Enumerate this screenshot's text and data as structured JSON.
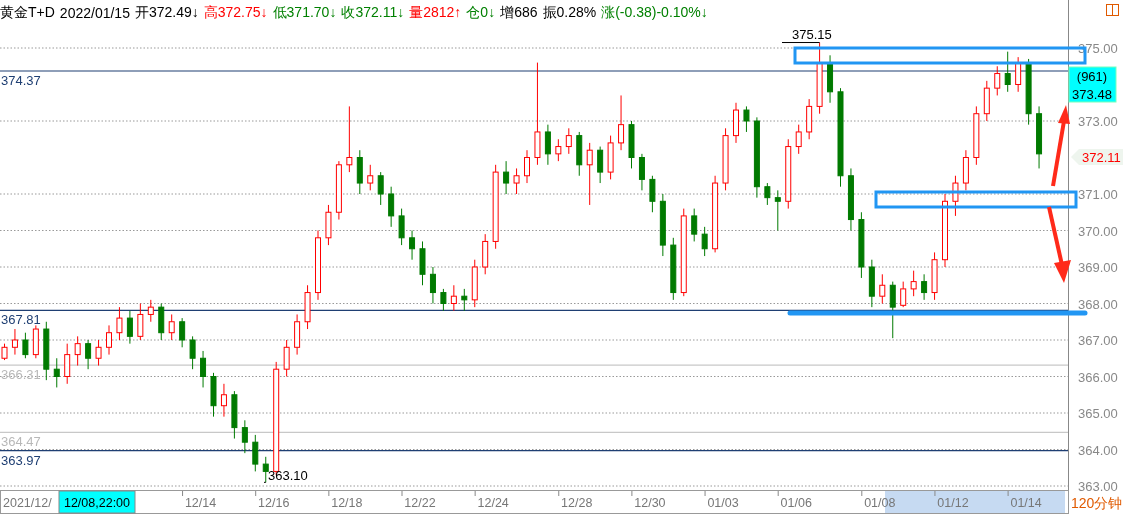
{
  "header": {
    "items": [
      {
        "text": "黄金T+D",
        "color": "#000000"
      },
      {
        "text": "2022/01/15",
        "color": "#000000"
      },
      {
        "text": "开372.49",
        "arrow": "↓",
        "color": "#000000"
      },
      {
        "text": "高372.75",
        "arrow": "↓",
        "color": "#ff0000"
      },
      {
        "text": "低371.70",
        "arrow": "↓",
        "color": "#008000"
      },
      {
        "text": "收372.11",
        "arrow": "↓",
        "color": "#008000"
      },
      {
        "text": "量2812",
        "arrow": "↑",
        "color": "#ff0000"
      },
      {
        "text": "仓0",
        "arrow": "↓",
        "color": "#008000"
      },
      {
        "text": "增686",
        "color": "#000000"
      },
      {
        "text": "振0.28%",
        "color": "#000000"
      },
      {
        "text": "涨(-0.38)-0.10%",
        "arrow": "↓",
        "color": "#008000"
      }
    ]
  },
  "chart": {
    "reference_lines": [
      {
        "label": "374.37",
        "kind": "strong"
      },
      {
        "label": "367.81",
        "kind": "strong"
      },
      {
        "label": "366.31",
        "kind": "faint"
      },
      {
        "label": "364.47",
        "kind": "faint"
      },
      {
        "label": "363.97",
        "kind": "strong"
      }
    ],
    "high_marker": "375.15",
    "low_marker": "363.10",
    "chart_data": {
      "type": "candlestick",
      "ylim": [
        363,
        375
      ],
      "grid": true,
      "yticks": [
        {
          "value": 375,
          "label": "375.00"
        },
        {
          "value": 373,
          "label": "373.00"
        },
        {
          "value": 371,
          "label": "371.00"
        },
        {
          "value": 370,
          "label": "370.00"
        },
        {
          "value": 369,
          "label": "369.00"
        },
        {
          "value": 368,
          "label": "368.00"
        },
        {
          "value": 367,
          "label": "367.00"
        },
        {
          "value": 366,
          "label": "366.00"
        },
        {
          "value": 365,
          "label": "365.00"
        },
        {
          "value": 364,
          "label": "364.00"
        },
        {
          "value": 363,
          "label": "363.00"
        }
      ],
      "categories": [
        null,
        null,
        null,
        null,
        null,
        null,
        null,
        null,
        null,
        null,
        null,
        null,
        null,
        null,
        null,
        null,
        null,
        null,
        null,
        "12/14",
        null,
        null,
        null,
        null,
        null,
        null,
        "12/16",
        null,
        null,
        null,
        null,
        null,
        null,
        "12/18",
        null,
        null,
        null,
        null,
        null,
        null,
        "12/22",
        null,
        null,
        null,
        null,
        null,
        null,
        "12/24",
        null,
        null,
        null,
        null,
        null,
        null,
        null,
        "12/28",
        null,
        null,
        null,
        null,
        null,
        null,
        "12/30",
        null,
        null,
        null,
        null,
        null,
        null,
        "01/03",
        null,
        null,
        null,
        null,
        null,
        null,
        "01/06",
        null,
        null,
        null,
        null,
        null,
        null,
        null,
        "01/08",
        null,
        null,
        null,
        null,
        null,
        null,
        "01/12",
        null,
        null,
        null,
        null,
        null,
        null,
        "01/14",
        null
      ],
      "ohlc": [
        [
          366.5,
          366.9,
          366.45,
          366.8
        ],
        [
          366.8,
          367.3,
          366.6,
          367.0
        ],
        [
          367.0,
          367.2,
          366.5,
          366.6
        ],
        [
          366.6,
          367.4,
          366.5,
          367.3
        ],
        [
          367.3,
          367.5,
          365.9,
          366.2
        ],
        [
          366.2,
          366.5,
          365.7,
          366.0
        ],
        [
          366.0,
          366.9,
          365.8,
          366.6
        ],
        [
          366.6,
          367.1,
          366.3,
          366.9
        ],
        [
          366.9,
          367.0,
          366.2,
          366.5
        ],
        [
          366.5,
          367.0,
          366.3,
          366.8
        ],
        [
          366.8,
          367.4,
          366.6,
          367.2
        ],
        [
          367.2,
          367.9,
          367.0,
          367.6
        ],
        [
          367.6,
          367.8,
          366.9,
          367.1
        ],
        [
          367.1,
          368.0,
          367.0,
          367.7
        ],
        [
          367.7,
          368.1,
          367.5,
          367.9
        ],
        [
          367.9,
          368.0,
          367.0,
          367.2
        ],
        [
          367.2,
          367.7,
          367.0,
          367.5
        ],
        [
          367.5,
          367.6,
          366.8,
          367.0
        ],
        [
          367.0,
          367.1,
          366.2,
          366.5
        ],
        [
          366.5,
          366.7,
          365.7,
          366.0
        ],
        [
          366.0,
          366.1,
          364.9,
          365.2
        ],
        [
          365.2,
          365.8,
          364.9,
          365.5
        ],
        [
          365.5,
          365.6,
          364.3,
          364.6
        ],
        [
          364.6,
          364.8,
          363.9,
          364.2
        ],
        [
          364.2,
          364.4,
          363.4,
          363.6
        ],
        [
          363.6,
          363.8,
          363.1,
          363.4
        ],
        [
          363.4,
          366.4,
          363.3,
          366.2
        ],
        [
          366.2,
          367.0,
          366.0,
          366.8
        ],
        [
          366.8,
          367.7,
          366.6,
          367.5
        ],
        [
          367.5,
          368.5,
          367.3,
          368.3
        ],
        [
          368.3,
          370.0,
          368.1,
          369.8
        ],
        [
          369.8,
          370.7,
          369.6,
          370.5
        ],
        [
          370.5,
          371.9,
          370.3,
          371.8
        ],
        [
          371.8,
          373.4,
          371.6,
          372.0
        ],
        [
          372.0,
          372.2,
          371.0,
          371.3
        ],
        [
          371.3,
          371.8,
          371.1,
          371.5
        ],
        [
          371.5,
          371.6,
          370.7,
          371.0
        ],
        [
          371.0,
          371.2,
          370.1,
          370.4
        ],
        [
          370.4,
          370.6,
          369.6,
          369.8
        ],
        [
          369.8,
          370.0,
          369.2,
          369.5
        ],
        [
          369.5,
          369.7,
          368.5,
          368.8
        ],
        [
          368.8,
          369.0,
          368.0,
          368.3
        ],
        [
          368.3,
          368.4,
          367.8,
          368.0
        ],
        [
          368.0,
          368.5,
          367.8,
          368.2
        ],
        [
          368.2,
          368.4,
          367.8,
          368.1
        ],
        [
          368.1,
          369.2,
          367.9,
          369.0
        ],
        [
          369.0,
          369.9,
          368.8,
          369.7
        ],
        [
          369.7,
          371.8,
          369.5,
          371.6
        ],
        [
          371.6,
          371.9,
          371.0,
          371.3
        ],
        [
          371.3,
          371.7,
          371.0,
          371.5
        ],
        [
          371.5,
          372.2,
          371.3,
          372.0
        ],
        [
          372.0,
          374.6,
          371.8,
          372.7
        ],
        [
          372.7,
          372.9,
          371.8,
          372.1
        ],
        [
          372.1,
          372.5,
          371.9,
          372.3
        ],
        [
          372.3,
          372.8,
          372.1,
          372.6
        ],
        [
          372.6,
          372.7,
          371.5,
          371.8
        ],
        [
          371.8,
          372.4,
          370.7,
          372.2
        ],
        [
          372.2,
          372.3,
          371.3,
          371.6
        ],
        [
          371.6,
          372.6,
          371.4,
          372.4
        ],
        [
          372.4,
          373.7,
          372.2,
          372.9
        ],
        [
          372.9,
          373.0,
          371.7,
          372.0
        ],
        [
          372.0,
          372.1,
          371.1,
          371.4
        ],
        [
          371.4,
          371.5,
          370.5,
          370.8
        ],
        [
          370.8,
          371.0,
          369.3,
          369.6
        ],
        [
          369.6,
          369.8,
          368.1,
          368.3
        ],
        [
          368.3,
          370.6,
          368.2,
          370.4
        ],
        [
          370.4,
          370.6,
          369.7,
          369.9
        ],
        [
          369.9,
          370.1,
          369.3,
          369.5
        ],
        [
          369.5,
          371.5,
          369.4,
          371.3
        ],
        [
          371.3,
          372.8,
          371.1,
          372.6
        ],
        [
          372.6,
          373.5,
          372.4,
          373.3
        ],
        [
          373.3,
          373.4,
          372.7,
          373.0
        ],
        [
          373.0,
          373.1,
          370.9,
          371.2
        ],
        [
          371.2,
          371.3,
          370.7,
          370.9
        ],
        [
          370.9,
          371.1,
          370.0,
          370.8
        ],
        [
          370.8,
          372.5,
          370.6,
          372.3
        ],
        [
          372.3,
          372.9,
          372.1,
          372.7
        ],
        [
          372.7,
          373.6,
          372.5,
          373.4
        ],
        [
          373.4,
          375.15,
          373.2,
          374.6
        ],
        [
          374.6,
          374.8,
          373.5,
          373.8
        ],
        [
          373.8,
          373.9,
          371.2,
          371.5
        ],
        [
          371.5,
          371.7,
          370.0,
          370.3
        ],
        [
          370.3,
          370.5,
          368.7,
          369.0
        ],
        [
          369.0,
          369.2,
          367.9,
          368.2
        ],
        [
          368.2,
          368.8,
          368.0,
          368.5
        ],
        [
          368.5,
          368.6,
          367.05,
          367.9
        ],
        [
          367.95,
          368.6,
          367.9,
          368.4
        ],
        [
          368.4,
          368.9,
          368.2,
          368.6
        ],
        [
          368.6,
          368.8,
          368.1,
          368.3
        ],
        [
          368.3,
          369.4,
          368.1,
          369.2
        ],
        [
          369.2,
          371.0,
          369.0,
          370.8
        ],
        [
          370.8,
          371.5,
          370.4,
          371.3
        ],
        [
          371.3,
          372.2,
          371.1,
          372.0
        ],
        [
          372.0,
          373.4,
          371.8,
          373.2
        ],
        [
          373.2,
          374.1,
          373.0,
          373.9
        ],
        [
          373.9,
          374.5,
          373.7,
          374.3
        ],
        [
          374.3,
          374.9,
          373.8,
          374.0
        ],
        [
          374.0,
          374.75,
          373.8,
          374.6
        ],
        [
          374.6,
          374.7,
          372.9,
          373.2
        ],
        [
          373.2,
          373.4,
          371.7,
          372.1
        ]
      ]
    }
  },
  "price_axis": {
    "last_price": "372.11",
    "cursor_count": "(961)",
    "cursor_price": "373.48"
  },
  "time_axis": {
    "start_label": "2021/12/",
    "cursor_label": "12/08,22:00",
    "period": "120分钟"
  }
}
